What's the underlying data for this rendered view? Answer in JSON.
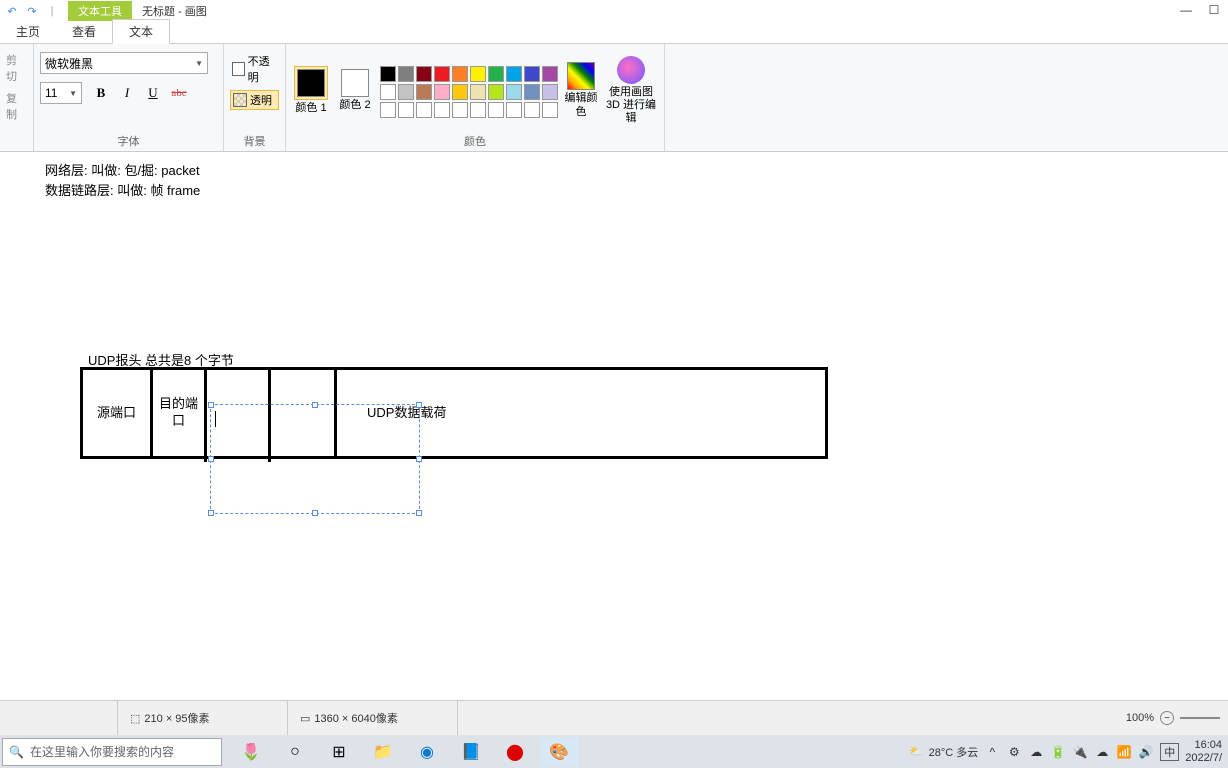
{
  "titlebar": {
    "tools_tab": "文本工具",
    "title": "无标题 - 画图"
  },
  "tabs": {
    "home": "主页",
    "view": "查看",
    "text": "文本"
  },
  "ribbon": {
    "clipboard": {
      "cut": "剪切",
      "copy": "复制"
    },
    "font": {
      "name": "微软雅黑",
      "size": "11",
      "group_label": "字体"
    },
    "background": {
      "opaque": "不透明",
      "transparent": "透明",
      "group_label": "背景"
    },
    "color1_label": "颜色 1",
    "color2_label": "颜色 2",
    "colors_label": "颜色",
    "edit_colors": "编辑颜色",
    "paint3d": "使用画图 3D 进行编辑"
  },
  "canvas": {
    "line1": "网络层:  叫做:  包/掘: packet",
    "line2": "数据链路层: 叫做: 帧 frame",
    "udp_title": "UDP报头  总共是8 个字节",
    "cell1": "源端口",
    "cell2": "目的端口",
    "cell5": "UDP数据载荷"
  },
  "statusbar": {
    "selection_size": "210 × 95像素",
    "canvas_size": "1360 × 6040像素",
    "zoom": "100%"
  },
  "taskbar": {
    "search_placeholder": "在这里输入你要搜索的内容",
    "weather": "28°C 多云",
    "ime": "中",
    "time": "16:04",
    "date": "2022/7/"
  },
  "palette": {
    "row1": [
      "#000000",
      "#7f7f7f",
      "#880015",
      "#ed1c24",
      "#ff7f27",
      "#fff200",
      "#22b14c",
      "#00a2e8",
      "#3f48cc",
      "#a349a4"
    ],
    "row2": [
      "#ffffff",
      "#c3c3c3",
      "#b97a57",
      "#ffaec9",
      "#ffc90e",
      "#efe4b0",
      "#b5e61d",
      "#99d9ea",
      "#7092be",
      "#c8bfe7"
    ],
    "row3": [
      "#ffffff",
      "#ffffff",
      "#ffffff",
      "#ffffff",
      "#ffffff",
      "#ffffff",
      "#ffffff",
      "#ffffff",
      "#ffffff",
      "#ffffff"
    ]
  }
}
